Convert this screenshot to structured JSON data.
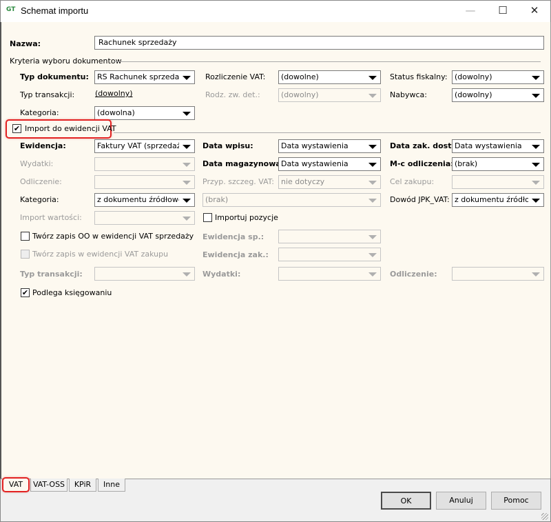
{
  "window": {
    "title": "Schemat importu",
    "minimize": "—",
    "maximize": "☐",
    "close": "✕"
  },
  "name": {
    "label": "Nazwa:",
    "value": "Rachunek sprzedaży"
  },
  "criteria": {
    "section": "Kryteria wyboru dokumentow",
    "typ_dokumentu": {
      "label": "Typ dokumentu:",
      "value": "RS Rachunek sprzedaży"
    },
    "rozliczenie_vat": {
      "label": "Rozliczenie VAT:",
      "value": "(dowolne)"
    },
    "status_fiskalny": {
      "label": "Status fiskalny:",
      "value": "(dowolny)"
    },
    "typ_transakcji": {
      "label": "Typ transakcji:",
      "value": "(dowolny)"
    },
    "rodz_zw_det": {
      "label": "Rodz. zw. det.:",
      "value": "(dowolny)"
    },
    "nabywca": {
      "label": "Nabywca:",
      "value": "(dowolny)"
    },
    "kategoria": {
      "label": "Kategoria:",
      "value": "(dowolna)"
    }
  },
  "import_vat": {
    "label": "Import do ewidencji VAT",
    "checked": true
  },
  "vat": {
    "ewidencja": {
      "label": "Ewidencja:",
      "value": "Faktury VAT (sprzedaż)"
    },
    "data_wpisu": {
      "label": "Data wpisu:",
      "value": "Data wystawienia"
    },
    "data_zak_dost": {
      "label": "Data zak. dost.:",
      "value": "Data wystawienia"
    },
    "wydatki": {
      "label": "Wydatki:",
      "value": ""
    },
    "data_magazynowa": {
      "label": "Data magazynowa:",
      "value": "Data wystawienia"
    },
    "mc_odliczenia": {
      "label": "M-c odliczenia:",
      "value": "(brak)"
    },
    "odliczenie": {
      "label": "Odliczenie:",
      "value": ""
    },
    "przyp_szczeg_vat": {
      "label": "Przyp. szczeg. VAT:",
      "value": "nie dotyczy"
    },
    "cel_zakupu": {
      "label": "Cel zakupu:",
      "value": ""
    },
    "kategoria": {
      "label": "Kategoria:",
      "value": "z dokumentu źródłowego"
    },
    "kategoria_opis": {
      "value": "(brak)"
    },
    "dowod_jpk": {
      "label": "Dowód JPK_VAT:",
      "value": "z dokumentu źródłowego"
    },
    "import_wartosci": {
      "label": "Import wartości:",
      "value": ""
    },
    "importuj_pozycje": {
      "label": "Importuj pozycje",
      "checked": false
    },
    "tworz_oo": {
      "label": "Twórz zapis OO w ewidencji VAT sprzedaży",
      "checked": false
    },
    "ewidencja_sp": {
      "label": "Ewidencja sp.:",
      "value": ""
    },
    "tworz_zakup": {
      "label": "Twórz zapis w ewidencji VAT zakupu",
      "checked": false
    },
    "ewidencja_zak": {
      "label": "Ewidencja zak.:",
      "value": ""
    },
    "typ_transakcji": {
      "label": "Typ transakcji:",
      "value": ""
    },
    "wydatki2": {
      "label": "Wydatki:",
      "value": ""
    },
    "odliczenie2": {
      "label": "Odliczenie:",
      "value": ""
    },
    "podlega": {
      "label": "Podlega księgowaniu",
      "checked": true
    }
  },
  "tabs": [
    {
      "label": "VAT",
      "active": true
    },
    {
      "label": "VAT-OSS"
    },
    {
      "label": "KPiR"
    },
    {
      "label": "Inne"
    }
  ],
  "buttons": {
    "ok": "OK",
    "cancel": "Anuluj",
    "help": "Pomoc"
  },
  "colors": {
    "highlight": "#e32222",
    "panel": "#fdf9f0"
  }
}
